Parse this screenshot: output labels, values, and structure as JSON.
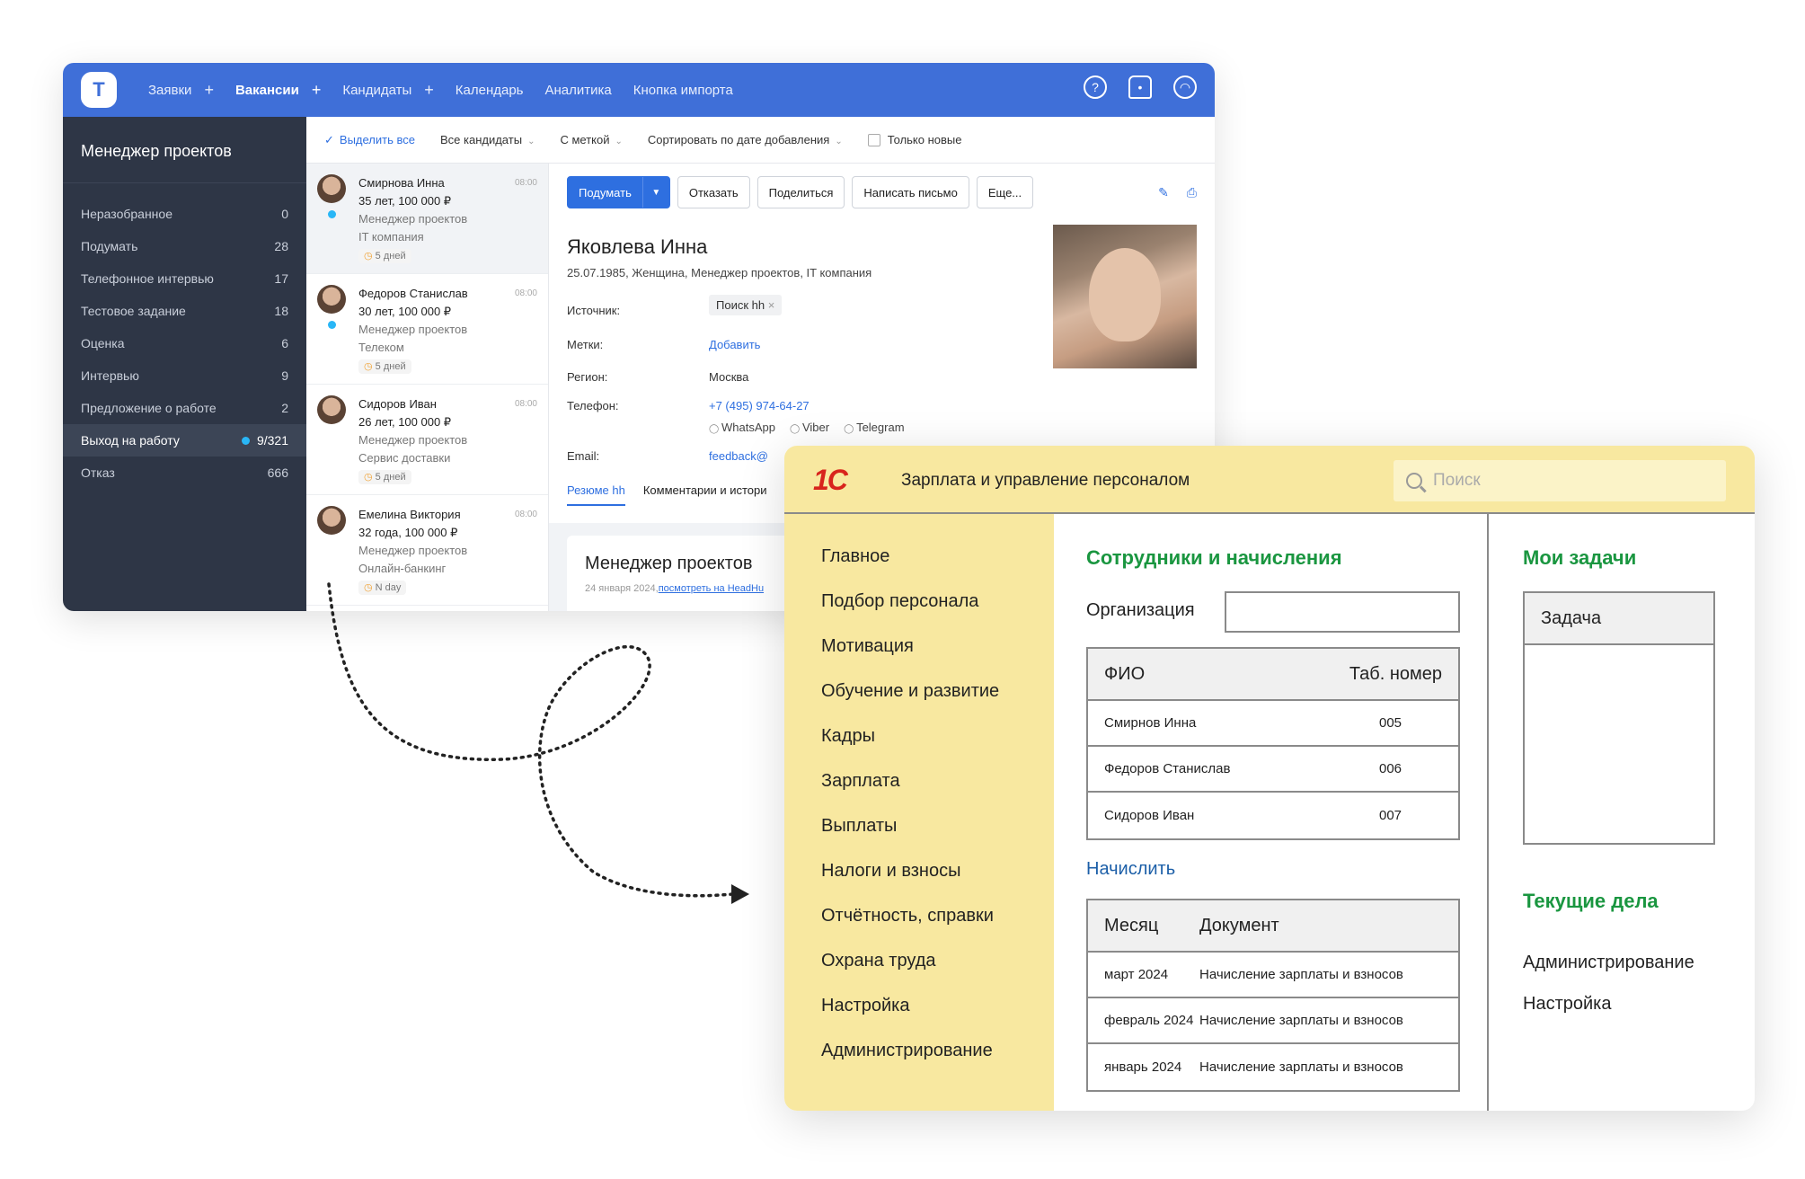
{
  "huntflow": {
    "nav": [
      {
        "label": "Заявки",
        "plus": "+"
      },
      {
        "label": "Вакансии",
        "plus": "+"
      },
      {
        "label": "Кандидаты",
        "plus": "+"
      },
      {
        "label": "Календарь"
      },
      {
        "label": "Аналитика"
      },
      {
        "label": "Кнопка импорта"
      }
    ],
    "logo": "T",
    "icons": [
      "help-icon",
      "bell-icon",
      "profile-icon"
    ],
    "sidebar": {
      "title": "Менеджер проектов",
      "items": [
        {
          "label": "Неразобранное",
          "count": "0"
        },
        {
          "label": "Подумать",
          "count": "28"
        },
        {
          "label": "Телефонное интервью",
          "count": "17"
        },
        {
          "label": "Тестовое задание",
          "count": "18"
        },
        {
          "label": "Оценка",
          "count": "6"
        },
        {
          "label": "Интервью",
          "count": "9"
        },
        {
          "label": "Предложение о работе",
          "count": "2"
        },
        {
          "label": "Выход на работу",
          "count": "9/321"
        },
        {
          "label": "Отказ",
          "count": "666"
        }
      ]
    },
    "filters": {
      "select_all": "Выделить все",
      "all_candidates": "Все кандидаты",
      "with_tag": "С меткой",
      "sort": "Сортировать по дате добавления",
      "only_new": "Только новые"
    },
    "candidates": [
      {
        "name": "Смирнова Инна",
        "salary": "35 лет, 100 000 ₽",
        "position": "Менеджер проектов",
        "company": "IT компания",
        "days": "5 дней",
        "time": "08:00"
      },
      {
        "name": "Федоров Станислав",
        "salary": "30 лет, 100 000 ₽",
        "position": "Менеджер проектов",
        "company": "Телеком",
        "days": "5 дней",
        "time": "08:00"
      },
      {
        "name": "Сидоров Иван",
        "salary": "26 лет, 100 000 ₽",
        "position": "Менеджер проектов",
        "company": "Сервис доставки",
        "days": "5 дней",
        "time": "08:00"
      },
      {
        "name": "Емелина Виктория",
        "salary": "32 года, 100 000 ₽",
        "position": "Менеджер проектов",
        "company": "Онлайн-банкинг",
        "days": "N day",
        "time": "08:00"
      }
    ],
    "actions": {
      "think": "Подумать",
      "reject": "Отказать",
      "share": "Поделиться",
      "write": "Написать письмо",
      "more": "Еще..."
    },
    "detail": {
      "name": "Яковлева Инна",
      "sub": "25.07.1985, Женщина, Менеджер проектов, IT компания",
      "source_label": "Источник:",
      "source_value": "Поиск hh",
      "tags_label": "Метки:",
      "tags_add": "Добавить",
      "region_label": "Регион:",
      "region_value": "Москва",
      "phone_label": "Телефон:",
      "phone_value": "+7 (495) 974-64-27",
      "messengers": [
        "WhatsApp",
        "Viber",
        "Telegram"
      ],
      "email_label": "Email:",
      "email_value": "feedback@",
      "tab_resume": "Резюме hh",
      "tab_comments": "Комментарии и истори",
      "card_title": "Менеджер проектов",
      "card_date": "24 января 2024,",
      "card_link": "посмотреть на HeadHu"
    }
  },
  "onec": {
    "logo": "1С",
    "title": "Зарплата и управление персоналом",
    "search_placeholder": "Поиск",
    "menu": [
      "Главное",
      "Подбор персонала",
      "Мотивация",
      "Обучение и развитие",
      "Кадры",
      "Зарплата",
      "Выплаты",
      "Налоги и взносы",
      "Отчётность, справки",
      "Охрана труда",
      "Настройка",
      "Администрирование"
    ],
    "employees_title": "Сотрудники и начисления",
    "org_label": "Организация",
    "emp_head": {
      "fio": "ФИО",
      "tab": "Таб. номер"
    },
    "employees": [
      {
        "name": "Смирнов Инна",
        "num": "005"
      },
      {
        "name": "Федоров Станислав",
        "num": "006"
      },
      {
        "name": "Сидоров Иван",
        "num": "007"
      }
    ],
    "accrue_link": "Начислить",
    "acc_head": {
      "month": "Месяц",
      "doc": "Документ"
    },
    "accruals": [
      {
        "month": "март 2024",
        "doc": "Начисление зарплаты и взносов"
      },
      {
        "month": "февраль 2024",
        "doc": "Начисление зарплаты и взносов"
      },
      {
        "month": "январь 2024",
        "doc": "Начисление зарплаты и взносов"
      }
    ],
    "tasks_title": "Мои задачи",
    "task_head": "Задача",
    "current_title": "Текущие дела",
    "current": [
      "Администрирование",
      "Настройка"
    ]
  },
  "colors": {
    "huntflow_blue": "#3f6fd8",
    "sidebar_dark": "#2e3646",
    "onec_yellow": "#f8e8a0",
    "onec_green": "#1a9640",
    "onec_red": "#d8241c"
  }
}
